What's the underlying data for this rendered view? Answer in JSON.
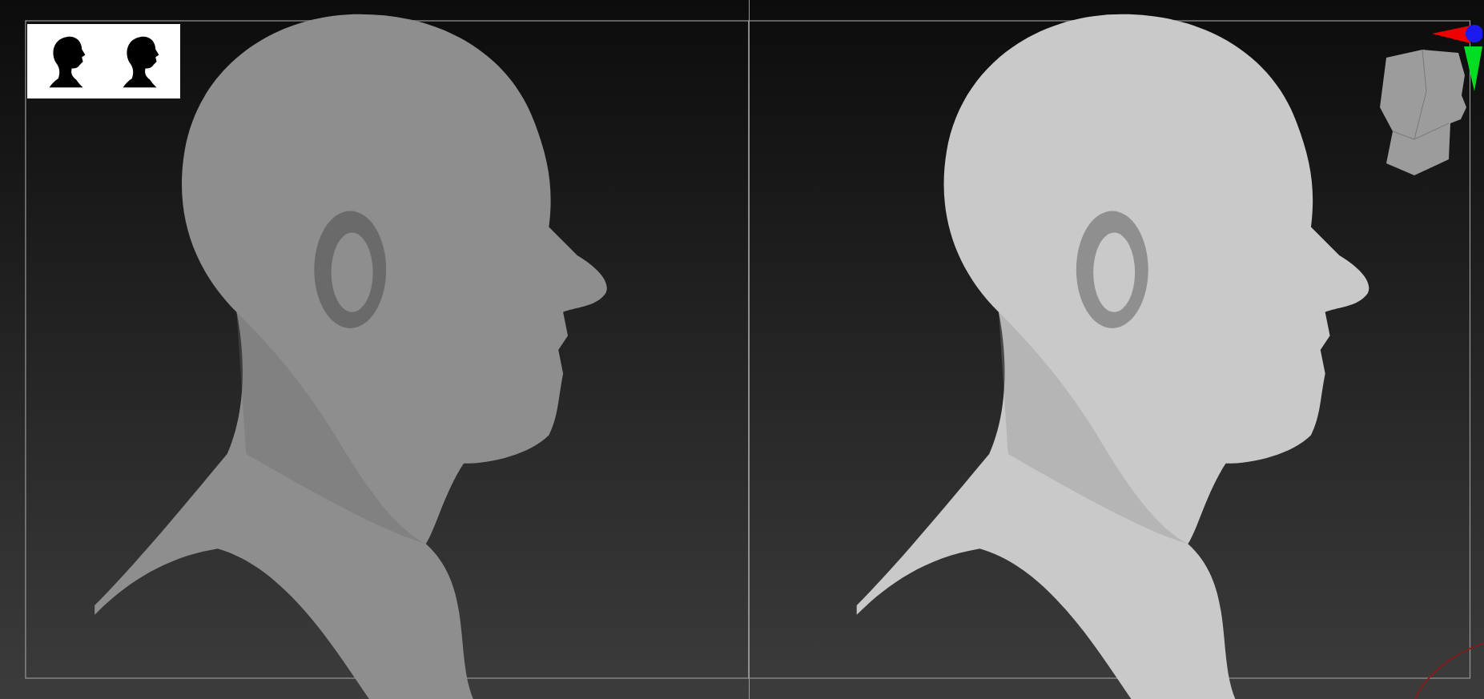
{
  "viewport": {
    "panels": [
      {
        "kind": "detailed-sculpt"
      },
      {
        "kind": "smooth-sculpt"
      }
    ]
  }
}
